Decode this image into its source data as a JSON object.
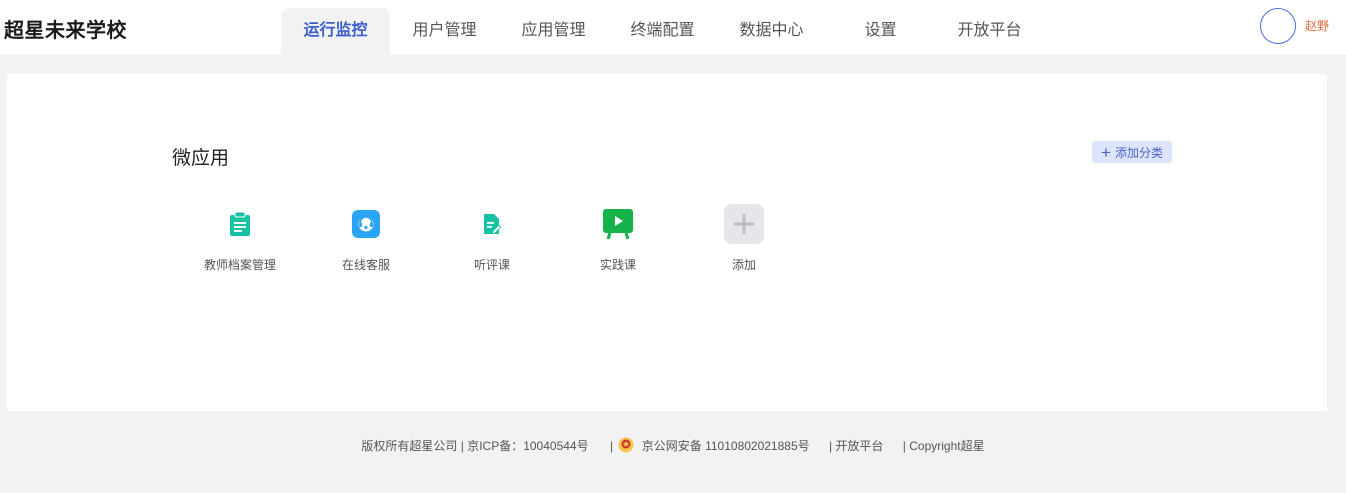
{
  "header": {
    "brand": "超星未来学校",
    "tabs": [
      {
        "label": "运行监控",
        "active": true
      },
      {
        "label": "用户管理",
        "active": false
      },
      {
        "label": "应用管理",
        "active": false
      },
      {
        "label": "终端配置",
        "active": false
      },
      {
        "label": "数据中心",
        "active": false
      },
      {
        "label": "设置",
        "active": false
      },
      {
        "label": "开放平台",
        "active": false
      }
    ],
    "username": "赵野"
  },
  "main": {
    "section_title": "微应用",
    "add_category_label": "添加分类",
    "apps": [
      {
        "label": "教师档案管理",
        "icon": "clipboard-icon",
        "color": "#17c2a4"
      },
      {
        "label": "在线客服",
        "icon": "customer-service-icon",
        "color": "#2aa4f4"
      },
      {
        "label": "听评课",
        "icon": "document-edit-icon",
        "color": "#17c2a4"
      },
      {
        "label": "实践课",
        "icon": "video-board-icon",
        "color": "#16b34a"
      },
      {
        "label": "添加",
        "icon": "plus-icon",
        "color": "#bcbcc4"
      }
    ]
  },
  "footer": {
    "copyright": "版权所有超星公司 | 京ICP备：10040544号",
    "police_sep": "|",
    "police": "京公网安备 11010802021885号",
    "open_platform": "| 开放平台",
    "copyright_en": "| Copyright超星"
  }
}
